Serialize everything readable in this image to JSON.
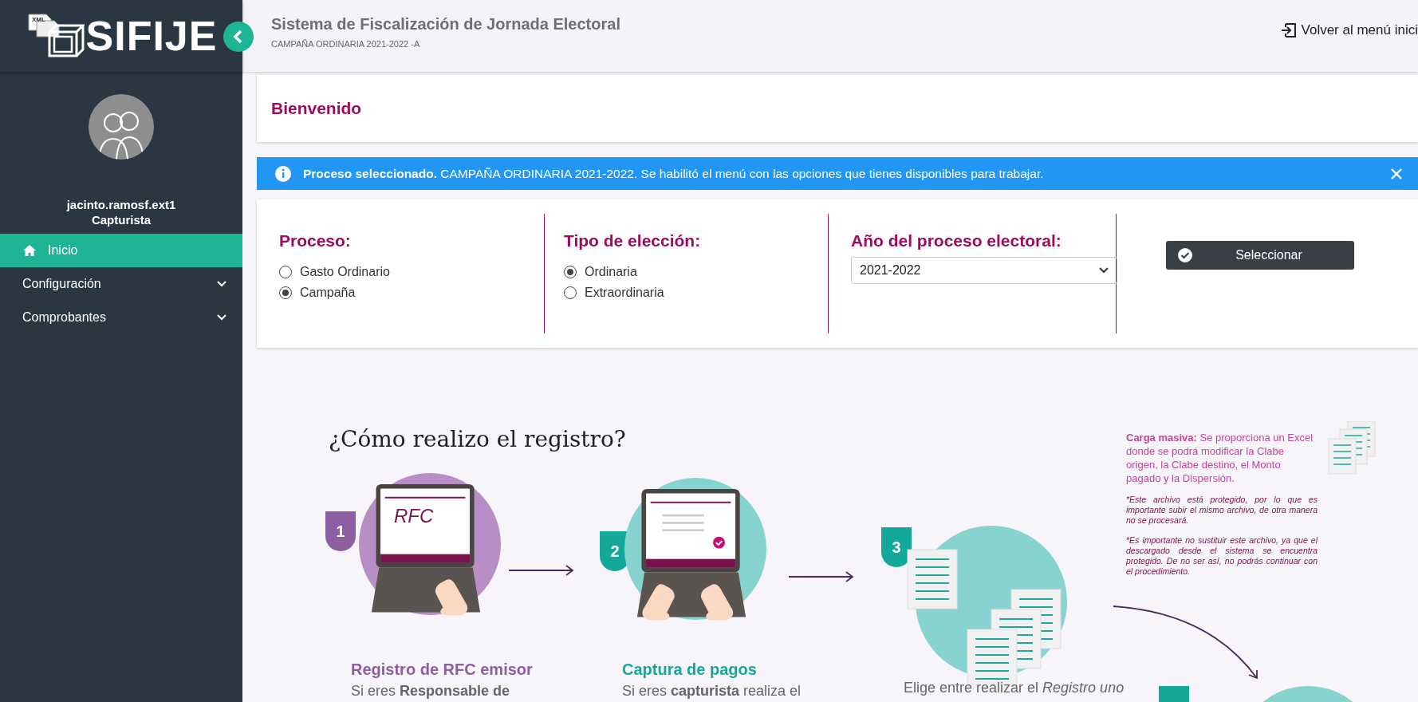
{
  "sidebar": {
    "logo_badge": "XML",
    "logo_text": "SIFIJE",
    "user": {
      "name": "jacinto.ramosf.ext1",
      "role": "Capturista"
    },
    "items": [
      {
        "label": "Inicio",
        "kind": "link",
        "selected": true
      },
      {
        "label": "Configuración",
        "kind": "dropdown",
        "selected": false
      },
      {
        "label": "Comprobantes",
        "kind": "dropdown",
        "selected": false
      }
    ]
  },
  "header": {
    "title": "Sistema de Fiscalización de Jornada Electoral",
    "subtitle": "CAMPAÑA ORDINARIA 2021-2022 -A",
    "back_link": "Volver al menú inici"
  },
  "welcome": {
    "title": "Bienvenido"
  },
  "alert": {
    "text": "**Proceso seleccionado.** CAMPAÑA ORDINARIA 2021-2022. Se habilitó el menú con las opciones que tienes disponibles para trabajar."
  },
  "form": {
    "groups": [
      {
        "label": "Proceso:",
        "kind": "radio",
        "options": [
          {
            "label": "Gasto Ordinario",
            "selected": false
          },
          {
            "label": "Campaña",
            "selected": true
          }
        ]
      },
      {
        "label": "Tipo de elección:",
        "kind": "radio",
        "options": [
          {
            "label": "Ordinaria",
            "selected": true
          },
          {
            "label": "Extraordinaria",
            "selected": false
          }
        ]
      },
      {
        "label": "Año del proceso electoral:",
        "kind": "select",
        "value": "2021-2022"
      }
    ],
    "button": "Seleccionar"
  },
  "infographic": {
    "title": "¿Cómo realizo el registro?",
    "steps": [
      {
        "number": "1",
        "kind": "rfc",
        "color": "#8e5ea2",
        "screen_text": "RFC",
        "title": "Registro de RFC emisor",
        "text": "Si eres **Responsable de**"
      },
      {
        "number": "2",
        "kind": "form",
        "color": "#14a89a",
        "title": "Captura de pagos",
        "text": "Si eres **capturista** realiza el"
      },
      {
        "number": "3",
        "kind": "docs",
        "color": "#14a89a",
        "text": "Elige entre realizar el *Registro uno*"
      }
    ],
    "note": {
      "text": "**Carga masiva:** Se proporciona un Excel donde se podrá modificar la Clabe origen, la Clabe destino, el Monto pagado y la Dispersión.",
      "warnings": [
        "*Este archivo está protegido, por lo que es importante subir el mismo archivo, de otra manera no se procesará.",
        "*Es importante no sustituir este archivo, ya que el descargado desde el sistema se encuentra protegido. De no ser así, no podrás continuar con el procedimiento."
      ]
    }
  }
}
